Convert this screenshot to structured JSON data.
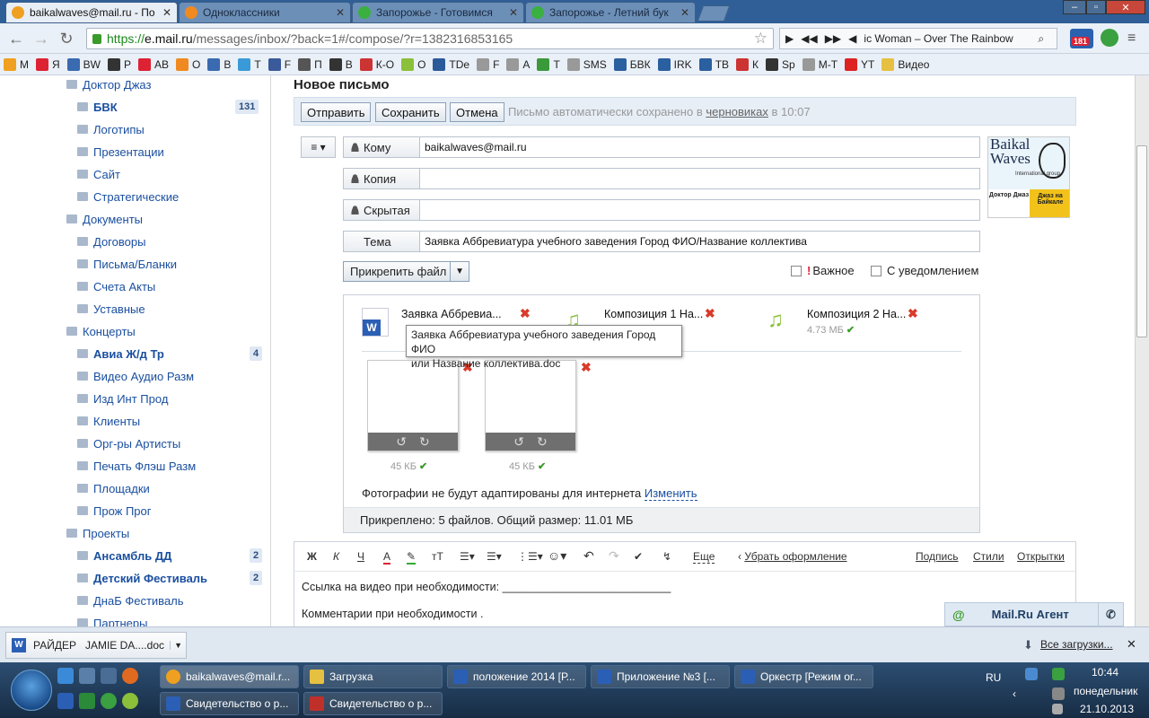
{
  "browser": {
    "tabs": [
      {
        "title": "baikalwaves@mail.ru - По",
        "active": true,
        "icon_color": "#f0a020"
      },
      {
        "title": "Одноклассники",
        "active": false,
        "icon_color": "#f08a20"
      },
      {
        "title": "Запорожье - Готовимся",
        "active": false,
        "icon_color": "#3ab040"
      },
      {
        "title": "Запорожье - Летний бук",
        "active": false,
        "icon_color": "#3ab040"
      }
    ],
    "url_scheme": "https://",
    "url_domain": "e.mail.ru",
    "url_path": "/messages/inbox/?back=1#/compose/?r=1382316853165",
    "media_track": "ic Woman – Over The Rainbow",
    "badge_count": "181",
    "bookmarks": [
      "М",
      "Я",
      "BW",
      "Р",
      "АВ",
      "О",
      "В",
      "Т",
      "F",
      "П",
      "В",
      "К-О",
      "О",
      "TDe",
      "F",
      "А",
      "Т",
      "SMS",
      "БВК",
      "IRK",
      "ТВ",
      "К",
      "Sp",
      "М-Т",
      "YT",
      "Видео"
    ]
  },
  "sidebar": {
    "items": [
      {
        "label": "Доктор Джаз",
        "level": 0,
        "bold": false,
        "badge": ""
      },
      {
        "label": "БВК",
        "level": 1,
        "bold": true,
        "badge": "131"
      },
      {
        "label": "Логотипы",
        "level": 1,
        "bold": false,
        "badge": ""
      },
      {
        "label": "Презентации",
        "level": 1,
        "bold": false,
        "badge": ""
      },
      {
        "label": "Сайт",
        "level": 1,
        "bold": false,
        "badge": ""
      },
      {
        "label": "Стратегические",
        "level": 1,
        "bold": false,
        "badge": ""
      },
      {
        "label": "Документы",
        "level": 0,
        "bold": false,
        "badge": ""
      },
      {
        "label": "Договоры",
        "level": 1,
        "bold": false,
        "badge": ""
      },
      {
        "label": "Письма/Бланки",
        "level": 1,
        "bold": false,
        "badge": ""
      },
      {
        "label": "Счета Акты",
        "level": 1,
        "bold": false,
        "badge": ""
      },
      {
        "label": "Уставные",
        "level": 1,
        "bold": false,
        "badge": ""
      },
      {
        "label": "Концерты",
        "level": 0,
        "bold": false,
        "badge": ""
      },
      {
        "label": "Авиа Ж/д Тр",
        "level": 1,
        "bold": true,
        "badge": "4"
      },
      {
        "label": "Видео Аудио Разм",
        "level": 1,
        "bold": false,
        "badge": ""
      },
      {
        "label": "Изд Инт Прод",
        "level": 1,
        "bold": false,
        "badge": ""
      },
      {
        "label": "Клиенты",
        "level": 1,
        "bold": false,
        "badge": ""
      },
      {
        "label": "Орг-ры Артисты",
        "level": 1,
        "bold": false,
        "badge": ""
      },
      {
        "label": "Печать Флэш Разм",
        "level": 1,
        "bold": false,
        "badge": ""
      },
      {
        "label": "Площадки",
        "level": 1,
        "bold": false,
        "badge": ""
      },
      {
        "label": "Прож Прог",
        "level": 1,
        "bold": false,
        "badge": ""
      },
      {
        "label": "Проекты",
        "level": 0,
        "bold": false,
        "badge": ""
      },
      {
        "label": "Ансамбль ДД",
        "level": 1,
        "bold": true,
        "badge": "2"
      },
      {
        "label": "Детский Фестиваль",
        "level": 1,
        "bold": true,
        "badge": "2"
      },
      {
        "label": "ДнаБ Фестиваль",
        "level": 1,
        "bold": false,
        "badge": ""
      },
      {
        "label": "Партнеры",
        "level": 1,
        "bold": false,
        "badge": ""
      }
    ]
  },
  "compose": {
    "title": "Новое письмо",
    "send_label": "Отправить",
    "save_label": "Сохранить",
    "cancel_label": "Отмена",
    "autosave_prefix": "Письмо автоматически сохранено в",
    "autosave_link": "черновиках",
    "autosave_time": "в 10:07",
    "to_label": "Кому",
    "to_value": "baikalwaves@mail.ru",
    "cc_label": "Копия",
    "cc_value": "",
    "bcc_label": "Скрытая",
    "bcc_value": "",
    "subject_label": "Тема",
    "subject_value": "Заявка Аббревиатура учебного заведения Город ФИО/Название коллектива",
    "attach_label": "Прикрепить файл",
    "important_mark": "!",
    "important_label": "Важное",
    "notify_label": "С уведомлением",
    "logo": {
      "line1": "Baikal",
      "line2": "Waves",
      "sub": "International group",
      "bottom_left": "Доктор Джаз",
      "bottom_right": "Джаз на Байкале"
    }
  },
  "attachments": {
    "files": [
      {
        "name": "Заявка Аббревиа...",
        "size": "",
        "type": "word"
      },
      {
        "name": "Композиция 1 На...",
        "size": "",
        "type": "audio"
      },
      {
        "name": "Композиция 2 На...",
        "size": "4.73 МБ",
        "type": "audio"
      }
    ],
    "tooltip_line1": "Заявка Аббревиатура учебного заведения Город ФИО",
    "tooltip_line2": "или Название коллектива.doc",
    "photos": [
      {
        "size": "45 КБ"
      },
      {
        "size": "45 КБ"
      }
    ],
    "photo_note": "Фотографии не будут адаптированы для интернета",
    "photo_note_link": "Изменить",
    "footer": "Прикреплено: 5 файлов. Общий размер: 11.01 МБ"
  },
  "editor": {
    "tools": [
      "Ж",
      "К",
      "Ч",
      "А",
      "тТ"
    ],
    "more_label": "Еще",
    "clear_label": "Убрать оформление",
    "signature_label": "Подпись",
    "styles_label": "Стили",
    "postcards_label": "Открытки",
    "body_line1": "Ссылка на видео при необходимости: ___________________________",
    "body_line2": "Комментарии при необходимости ."
  },
  "agent": {
    "label": "Mail.Ru Агент"
  },
  "downloads": {
    "file": "РАЙДЕР   JAMIE DA....doc",
    "all_label": "Все загрузки..."
  },
  "taskbar": {
    "buttons": [
      {
        "label": "baikalwaves@mail.r...",
        "icon_color": "#f0a020"
      },
      {
        "label": "Загрузка",
        "icon_color": "#e6c040"
      },
      {
        "label": "положение 2014 [Р...",
        "icon_color": "#2b5fb5"
      },
      {
        "label": "Приложение №3 [...",
        "icon_color": "#2b5fb5"
      },
      {
        "label": "Оркестр [Режим ог...",
        "icon_color": "#2b5fb5"
      },
      {
        "label": "Свидетельство о р...",
        "icon_color": "#2b5fb5"
      },
      {
        "label": "Свидетельство о р...",
        "icon_color": "#c0302a"
      }
    ],
    "lang": "RU",
    "time": "10:44",
    "weekday": "понедельник",
    "date": "21.10.2013"
  },
  "colors": {
    "link": "#1a4fa0",
    "accent_bar": "#e7eef6",
    "taskbar": "#1f3b5a",
    "delete": "#d93a2a",
    "ok": "#3a9a2a"
  }
}
